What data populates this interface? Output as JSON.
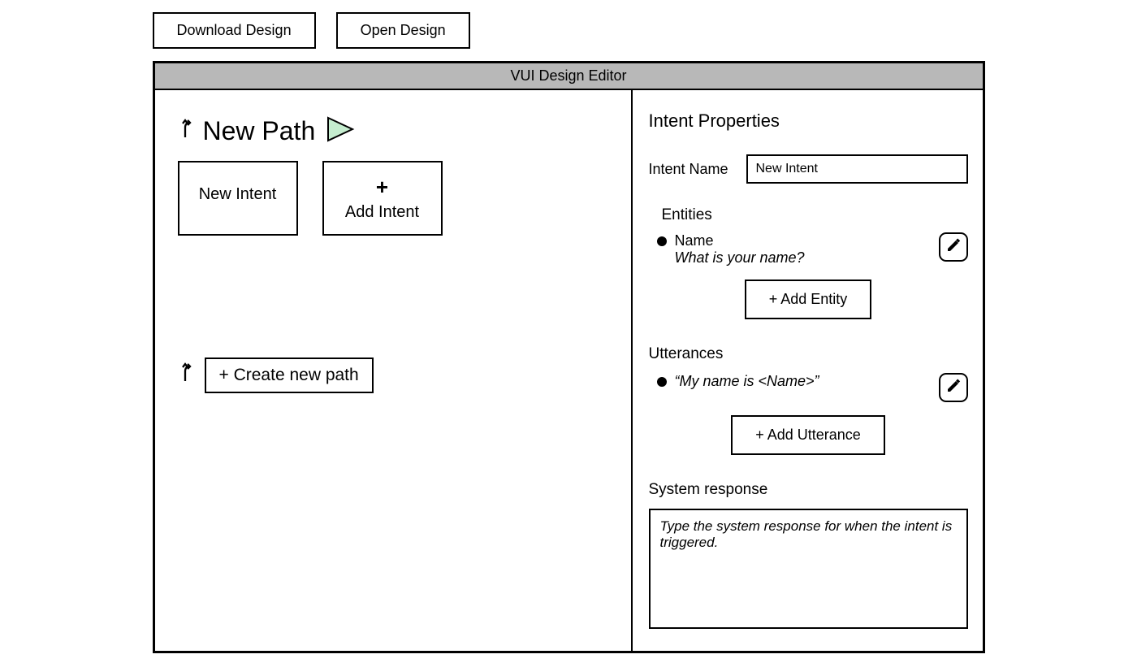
{
  "topButtons": {
    "download": "Download Design",
    "open": "Open Design"
  },
  "window": {
    "title": "VUI Design Editor"
  },
  "leftPane": {
    "pathTitle": "New Path",
    "intentBoxLabel": "New Intent",
    "addIntentLabel": "Add Intent",
    "createNewPathLabel": "+ Create new path"
  },
  "rightPane": {
    "panelTitle": "Intent Properties",
    "intentNameLabel": "Intent Name",
    "intentNameValue": "New Intent",
    "entitiesTitle": "Entities",
    "entity": {
      "name": "Name",
      "question": "What is your name?"
    },
    "addEntityLabel": "+ Add Entity",
    "utterancesTitle": "Utterances",
    "utterance": {
      "text": "“My name is <Name>”"
    },
    "addUtteranceLabel": "+ Add Utterance",
    "systemResponseTitle": "System response",
    "systemResponsePlaceholder": "Type the system response for when the intent is triggered."
  }
}
